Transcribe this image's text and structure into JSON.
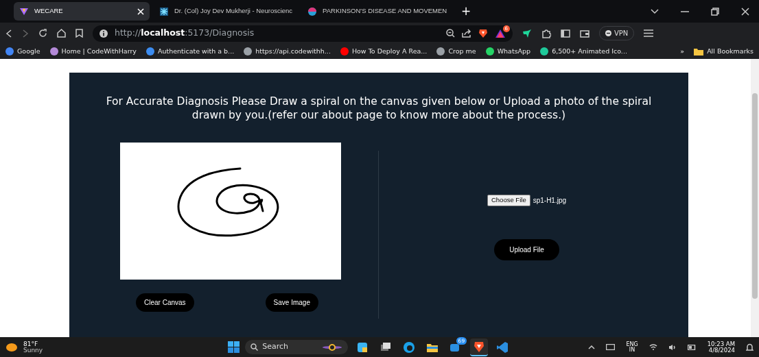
{
  "browser_tabs": [
    {
      "title": "WECARE",
      "selected": true
    },
    {
      "title": "Dr. (Col) Joy Dev Mukherji - Neuroscienc",
      "selected": false
    },
    {
      "title": "PARKINSON'S DISEASE AND MOVEMEN",
      "selected": false
    }
  ],
  "new_tab": "+",
  "address_bar": {
    "url": "http://**localhost**:5173/Diagnosis"
  },
  "notification_badge": "6",
  "vpn_button": "VPN",
  "bookmarks": [
    {
      "label": "Google",
      "color": "#4285f4"
    },
    {
      "label": "Home | CodeWithHarry",
      "color": "#b48ad8"
    },
    {
      "label": "Authenticate with a b...",
      "color": "#3c8cf0"
    },
    {
      "label": "https://api.codewithh...",
      "color": "#9aa0a6"
    },
    {
      "label": "How To Deploy A Rea...",
      "color": "#ff0000"
    },
    {
      "label": "Crop me",
      "color": "#9aa0a6"
    },
    {
      "label": "WhatsApp",
      "color": "#25d366"
    },
    {
      "label": "6,500+ Animated Ico...",
      "color": "#1fc99a"
    }
  ],
  "bookmarks_overflow": "»",
  "all_bookmarks": "All Bookmarks",
  "page": {
    "heading": "For Accurate Diagnosis Please Draw a spiral on the canvas given below or Upload a photo of the spiral drawn by you.(refer our about page to know more about the process.)",
    "canvas_buttons": [
      "Clear Canvas",
      "Save Image"
    ],
    "file_input": {
      "button": "Choose File",
      "file_name": "sp1-H1.jpg"
    },
    "upload_button": "Upload File"
  },
  "taskbar": {
    "weather": {
      "temperature": "81°F",
      "condition": "Sunny"
    },
    "search": {
      "placeholder": "Search"
    },
    "apps": [
      {
        "kind": "colorful",
        "selected": false
      },
      {
        "kind": "windows",
        "selected": false
      },
      {
        "kind": "edge",
        "selected": false
      },
      {
        "kind": "folder",
        "selected": false
      },
      {
        "kind": "chat",
        "selected": false,
        "badge": "69"
      },
      {
        "kind": "brave",
        "selected": true
      },
      {
        "kind": "code",
        "selected": false
      }
    ],
    "language": "ENG",
    "region": "IN",
    "time": "10:23 AM",
    "date": "4/8/2024"
  }
}
